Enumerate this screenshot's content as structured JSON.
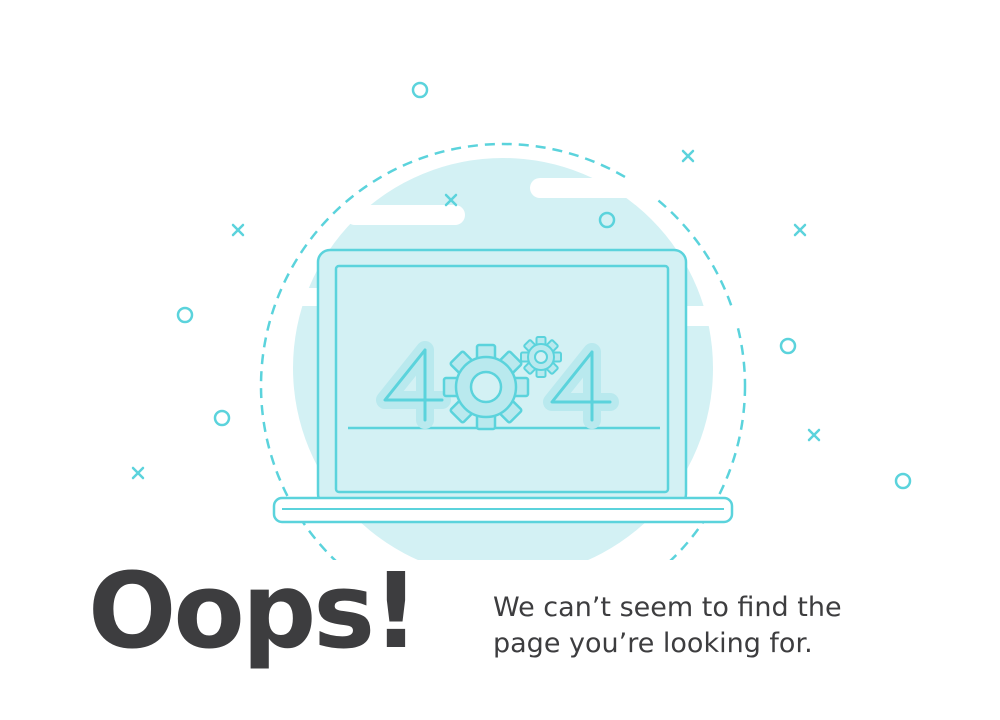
{
  "illustration": {
    "error_code": "404",
    "colors": {
      "stroke": "#5bd3dc",
      "fill": "#d3f1f4",
      "fill_dark": "#b9e9ee",
      "background": "#ffffff",
      "text": "#3d3d3f"
    },
    "icons": [
      "laptop-icon",
      "gear-icon",
      "circle-icon",
      "cross-icon",
      "cloud-icon"
    ]
  },
  "message": {
    "headline": "Oops!",
    "line1": "We can’t seem to find the",
    "line2": "page you’re looking for."
  }
}
